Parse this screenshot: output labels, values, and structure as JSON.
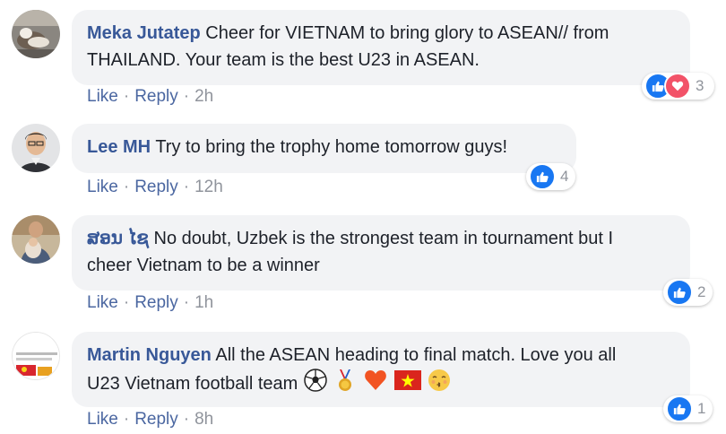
{
  "comments": [
    {
      "author": "Meka Jutatep",
      "text_line1": "Cheer for VIETNAM to bring glory to ASEAN// from",
      "text_line2": "THAILAND. Your team is the best U23 in ASEAN.",
      "like_label": "Like",
      "reply_label": "Reply",
      "time": "2h",
      "reaction_count": "3",
      "reactions": [
        "like-icon",
        "love-icon"
      ]
    },
    {
      "author": "Lee MH",
      "text_line1": "Try to bring the trophy home tomorrow guys!",
      "like_label": "Like",
      "reply_label": "Reply",
      "time": "12h",
      "reaction_count": "4",
      "reactions": [
        "like-icon"
      ]
    },
    {
      "author": "ສອນ ໄຊ",
      "text_line1": "No doubt, Uzbek is the strongest team in tournament but I",
      "text_line2": "cheer Vietnam to be a winner",
      "like_label": "Like",
      "reply_label": "Reply",
      "time": "1h",
      "reaction_count": "2",
      "reactions": [
        "like-icon"
      ]
    },
    {
      "author": "Martin Nguyen",
      "text_line1": "All the ASEAN heading to final match. Love you all",
      "text_line2": "U23 Vietnam football team",
      "emojis": [
        "soccer-ball-icon",
        "medal-icon",
        "heart-icon",
        "vietnam-flag-icon",
        "kissing-face-icon"
      ],
      "like_label": "Like",
      "reply_label": "Reply",
      "time": "8h",
      "reaction_count": "1",
      "reactions": [
        "like-icon"
      ]
    }
  ],
  "colors": {
    "author": "#385898",
    "bubble": "#f2f3f5",
    "link": "#4b67a1",
    "meta": "#90949c",
    "like": "#1877f2",
    "love": "#f25268"
  }
}
